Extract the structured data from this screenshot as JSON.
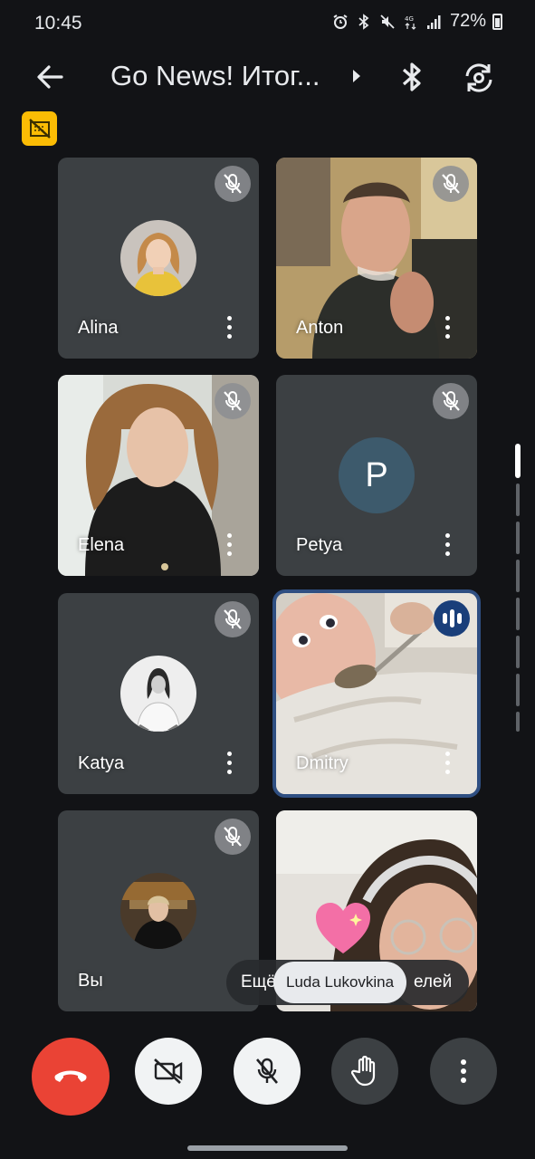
{
  "status": {
    "time": "10:45",
    "battery": "72%"
  },
  "header": {
    "title": "Go News! Итог..."
  },
  "participants": [
    {
      "name": "Alina"
    },
    {
      "name": "Anton"
    },
    {
      "name": "Elena"
    },
    {
      "name": "Petya",
      "initial": "P"
    },
    {
      "name": "Katya"
    },
    {
      "name": "Dmitry"
    },
    {
      "name": "Вы"
    },
    {
      "name": "Luda Lukovkina"
    }
  ],
  "overlay": {
    "more_label": "Ещё",
    "toast": "Luda Lukovkina",
    "behind_text": "елей"
  },
  "colors": {
    "end_call": "#ea4335",
    "badge_yellow": "#fbbc04",
    "speaking_border": "#2f4f82"
  }
}
